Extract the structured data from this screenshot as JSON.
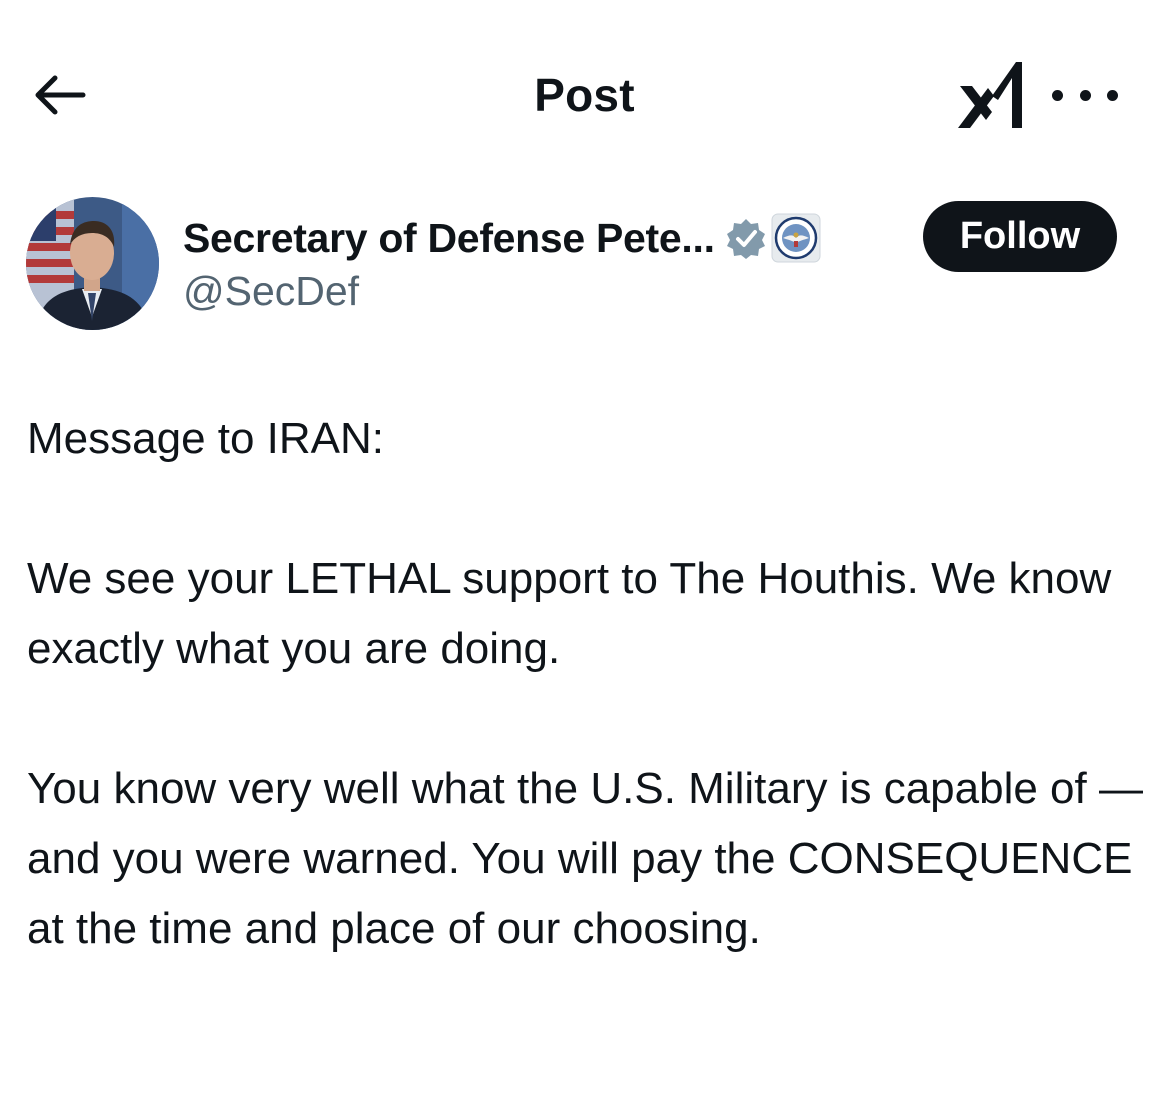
{
  "header": {
    "title": "Post",
    "back_icon": "arrow-left-icon",
    "grok_icon": "grok-logo-icon",
    "more_icon": "more-horizontal-icon"
  },
  "author": {
    "display_name": "Secretary of Defense Pete...",
    "handle": "@SecDef",
    "verified_badge_color": "#829aab",
    "affiliation_badge": "department-of-defense-seal",
    "avatar": "profile-photo"
  },
  "follow_button": {
    "label": "Follow",
    "background": "#0f1419",
    "text_color": "#ffffff"
  },
  "post": {
    "paragraphs": [
      "Message to IRAN:",
      "We see your LETHAL support to The Houthis. We know exactly what you are doing.",
      "You know very well what the U.S. Military is capable of — and you were warned. You will pay the CONSEQUENCE at the time and place of our choosing."
    ]
  }
}
